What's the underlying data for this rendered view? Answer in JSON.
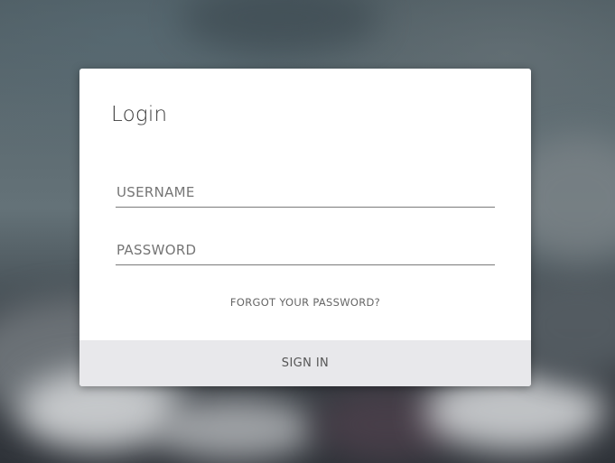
{
  "login": {
    "title": "Login",
    "username_placeholder": "USERNAME",
    "username_value": "",
    "password_placeholder": "PASSWORD",
    "password_value": "",
    "forgot_label": "FORGOT YOUR PASSWORD?",
    "signin_label": "SIGN IN"
  },
  "colors": {
    "card": "#ffffff",
    "signin_bar": "#e8e8eb",
    "text": "#555555"
  }
}
